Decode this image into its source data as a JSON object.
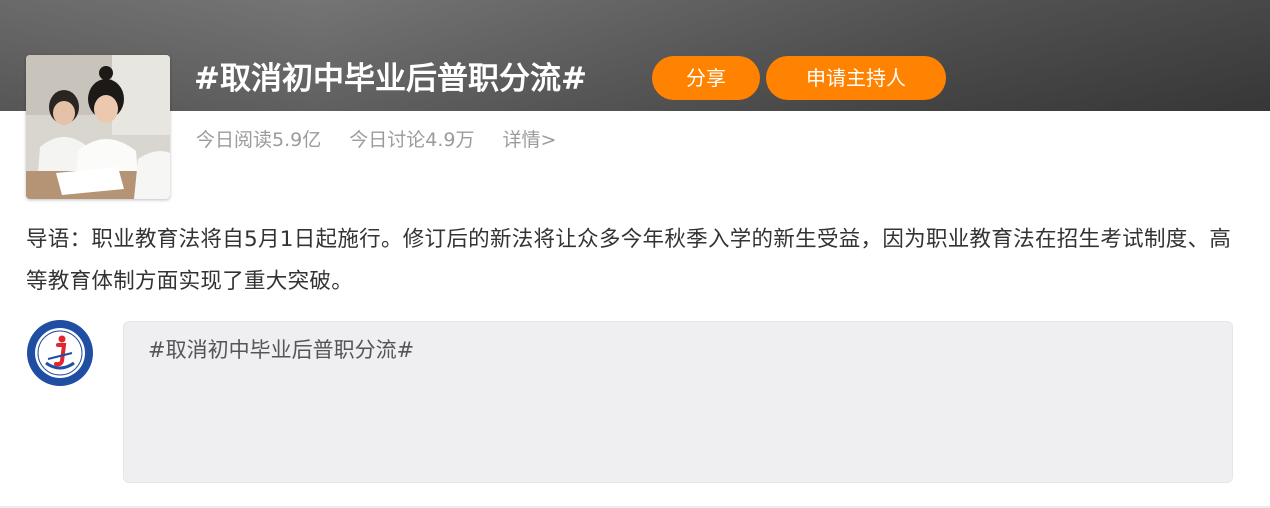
{
  "topic": {
    "title": "#取消初中毕业后普职分流#",
    "share_label": "分享",
    "host_label": "申请主持人"
  },
  "stats": {
    "reads": "今日阅读5.9亿",
    "discussions": "今日讨论4.9万",
    "details_link": "详情>"
  },
  "intro": {
    "text": "导语：职业教育法将自5月1日起施行。修订后的新法将让众多今年秋季入学的新生受益，因为职业教育法在招生考试制度、高等教育体制方面实现了重大突破。"
  },
  "composer": {
    "value": "#取消初中毕业后普职分流#"
  },
  "colors": {
    "accent": "#ff8200",
    "header_band": "#5a5a5a",
    "stats_text": "#9b9b9b",
    "body_text": "#333333",
    "composer_bg": "#efeff2",
    "logo_blue": "#1f4ea3",
    "logo_red": "#e0262e"
  },
  "icons": {
    "cover": "students-exam-photo",
    "avatar": "school-logo-icon"
  }
}
